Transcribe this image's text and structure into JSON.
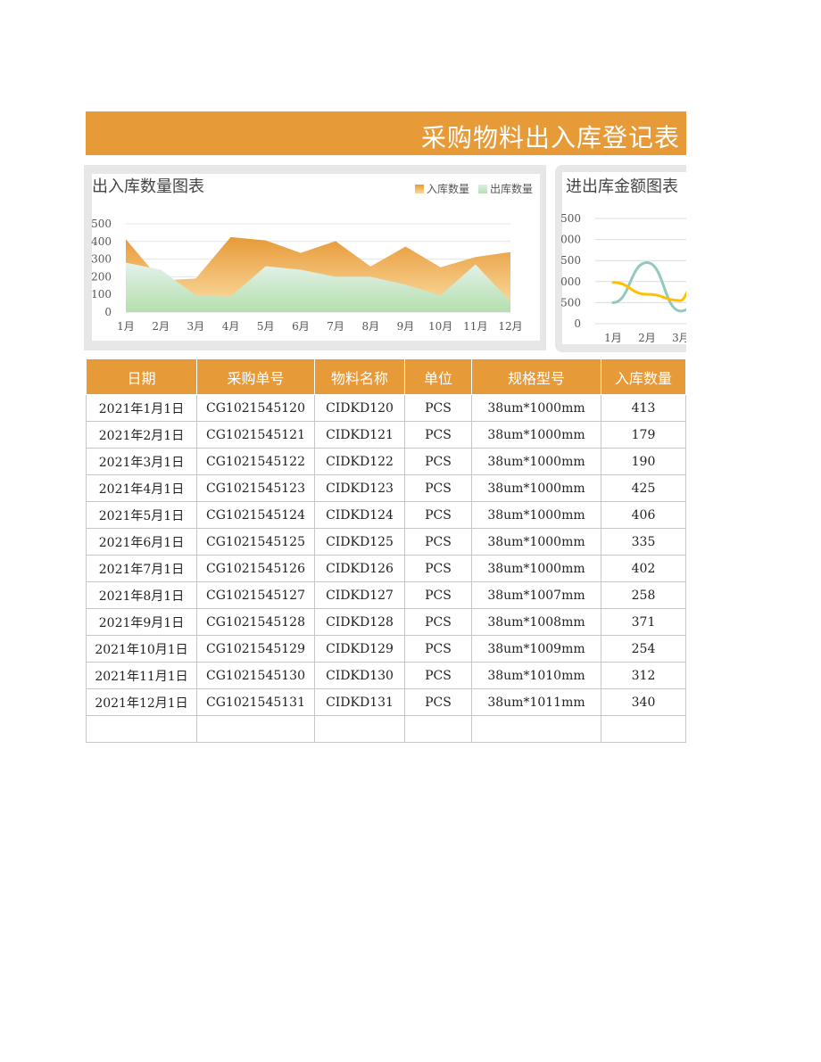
{
  "title": "采购物料出入库登记表",
  "accent_color": "#E79A38",
  "chart_data": [
    {
      "type": "area",
      "title": "出入库数量图表",
      "categories": [
        "1月",
        "2月",
        "3月",
        "4月",
        "5月",
        "6月",
        "7月",
        "8月",
        "9月",
        "10月",
        "11月",
        "12月"
      ],
      "series": [
        {
          "name": "入库数量",
          "values": [
            413,
            179,
            190,
            425,
            406,
            335,
            402,
            258,
            371,
            254,
            312,
            340
          ],
          "color": "#E79A38"
        },
        {
          "name": "出库数量",
          "values": [
            280,
            240,
            95,
            88,
            260,
            240,
            200,
            200,
            155,
            95,
            270,
            60
          ],
          "color": "#B6E0B0"
        }
      ],
      "ylim": [
        0,
        500
      ],
      "yticks": [
        "0",
        "100",
        "200",
        "300",
        "400",
        "500"
      ],
      "grid": true,
      "legend": "top-right"
    },
    {
      "type": "line",
      "title": "进出库金额图表",
      "categories": [
        "1月",
        "2月",
        "3月"
      ],
      "series": [
        {
          "values": [
            500,
            1450,
            300
          ],
          "color": "#93C8BE"
        },
        {
          "values": [
            980,
            700,
            550
          ],
          "color": "#FFC000"
        }
      ],
      "ylim": [
        0,
        2500
      ],
      "yticks": [
        "0",
        "500",
        "000",
        "500",
        "000",
        "500"
      ],
      "grid": true
    }
  ],
  "table": {
    "headers": [
      "日期",
      "采购单号",
      "物料名称",
      "单位",
      "规格型号",
      "入库数量"
    ],
    "rows": [
      [
        "2021年1月1日",
        "CG1021545120",
        "CIDKD120",
        "PCS",
        "38um*1000mm",
        "413"
      ],
      [
        "2021年2月1日",
        "CG1021545121",
        "CIDKD121",
        "PCS",
        "38um*1000mm",
        "179"
      ],
      [
        "2021年3月1日",
        "CG1021545122",
        "CIDKD122",
        "PCS",
        "38um*1000mm",
        "190"
      ],
      [
        "2021年4月1日",
        "CG1021545123",
        "CIDKD123",
        "PCS",
        "38um*1000mm",
        "425"
      ],
      [
        "2021年5月1日",
        "CG1021545124",
        "CIDKD124",
        "PCS",
        "38um*1000mm",
        "406"
      ],
      [
        "2021年6月1日",
        "CG1021545125",
        "CIDKD125",
        "PCS",
        "38um*1000mm",
        "335"
      ],
      [
        "2021年7月1日",
        "CG1021545126",
        "CIDKD126",
        "PCS",
        "38um*1000mm",
        "402"
      ],
      [
        "2021年8月1日",
        "CG1021545127",
        "CIDKD127",
        "PCS",
        "38um*1007mm",
        "258"
      ],
      [
        "2021年9月1日",
        "CG1021545128",
        "CIDKD128",
        "PCS",
        "38um*1008mm",
        "371"
      ],
      [
        "2021年10月1日",
        "CG1021545129",
        "CIDKD129",
        "PCS",
        "38um*1009mm",
        "254"
      ],
      [
        "2021年11月1日",
        "CG1021545130",
        "CIDKD130",
        "PCS",
        "38um*1010mm",
        "312"
      ],
      [
        "2021年12月1日",
        "CG1021545131",
        "CIDKD131",
        "PCS",
        "38um*1011mm",
        "340"
      ],
      [
        "",
        "",
        "",
        "",
        "",
        ""
      ]
    ]
  }
}
